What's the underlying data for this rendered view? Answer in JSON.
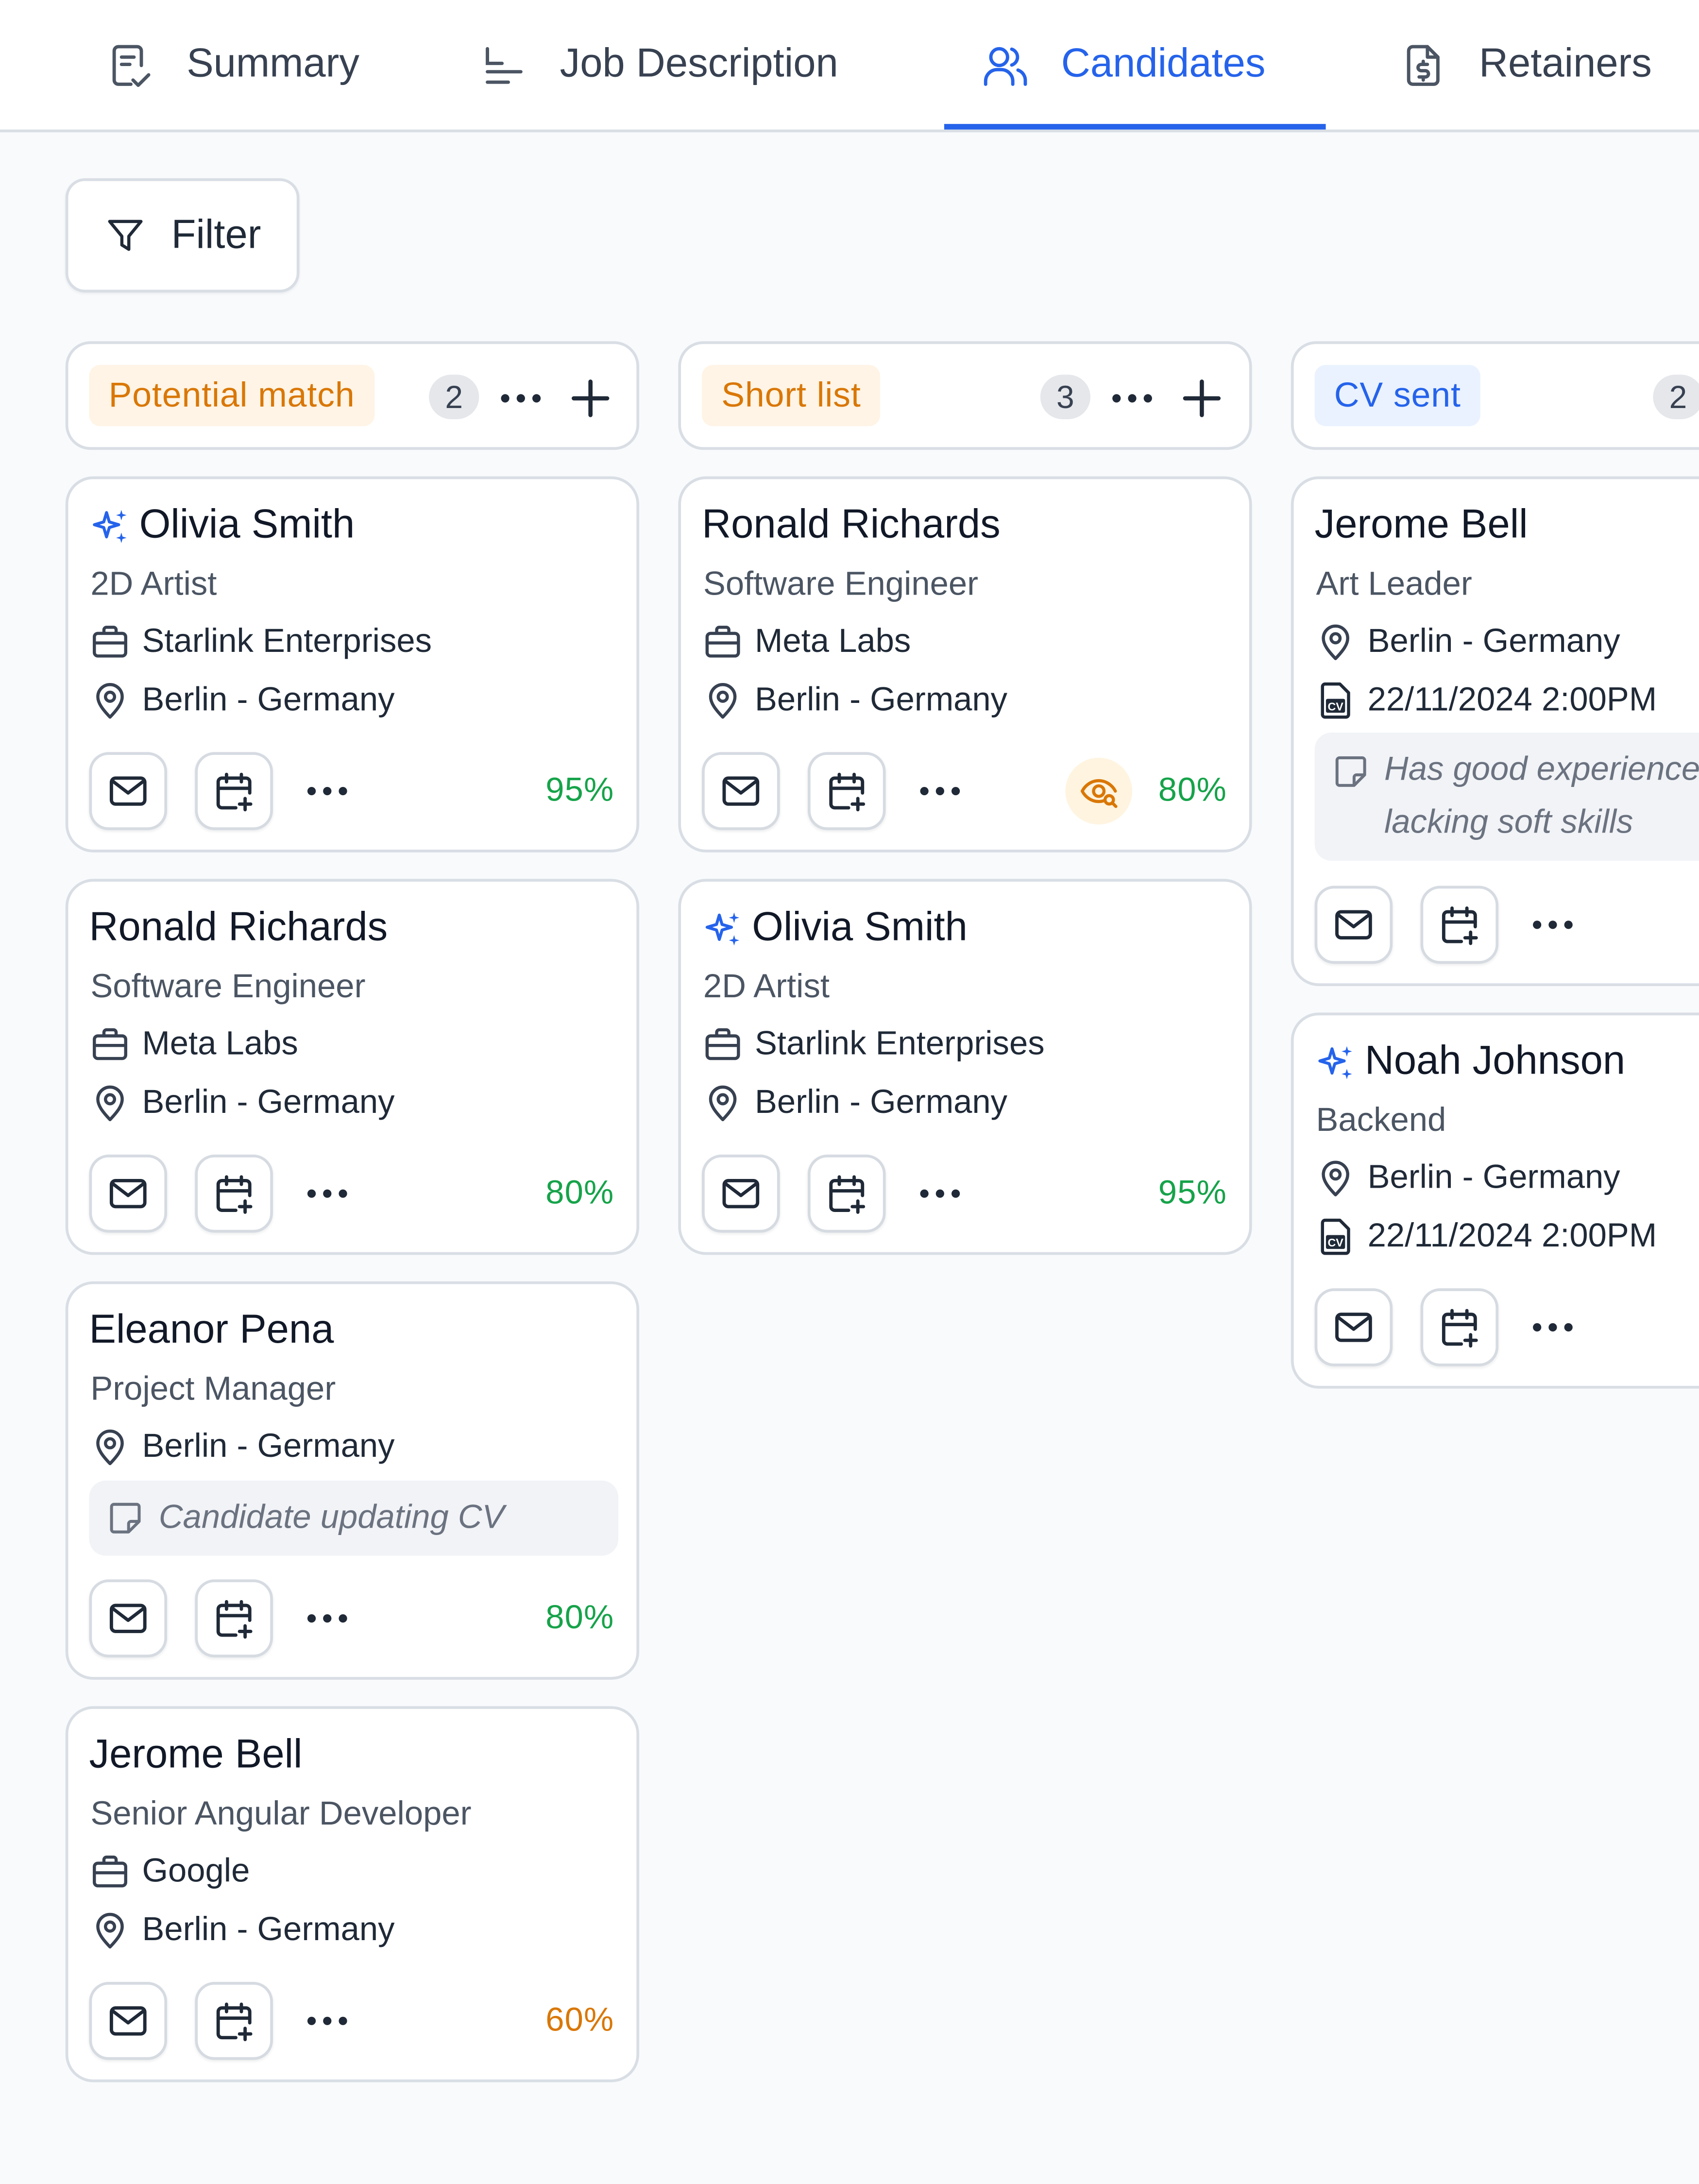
{
  "tabs": [
    {
      "label": "Summary",
      "icon": "clipboard-check-icon"
    },
    {
      "label": "Job Description",
      "icon": "align-left-icon"
    },
    {
      "label": "Candidates",
      "icon": "users-icon"
    },
    {
      "label": "Retainers",
      "icon": "file-dollar-icon"
    }
  ],
  "active_tab": "Candidates",
  "filter": {
    "label": "Filter",
    "icon": "filter-icon"
  },
  "colors": {
    "accent": "#2563eb",
    "green": "#16a34a",
    "orange": "#d97706"
  },
  "columns": [
    {
      "status": "Potential match",
      "count": "2",
      "cards": [
        {
          "name": "Olivia Smith",
          "ai": true,
          "role": "2D Artist",
          "company": "Starlink Enterprises",
          "location": "Berlin - Germany",
          "match": "95%"
        },
        {
          "name": "Ronald Richards",
          "ai": false,
          "role": "Software Engineer",
          "company": "Meta Labs",
          "location": "Berlin - Germany",
          "match": "80%"
        },
        {
          "name": "Eleanor Pena",
          "ai": false,
          "role": "Project Manager",
          "location": "Berlin - Germany",
          "note": "Candidate updating CV",
          "match": "80%"
        },
        {
          "name": "Jerome Bell",
          "ai": false,
          "role": "Senior Angular Developer",
          "company": "Google",
          "location": "Berlin - Germany",
          "match": "60%"
        }
      ]
    },
    {
      "status": "Short list",
      "count": "3",
      "cards": [
        {
          "name": "Ronald Richards",
          "ai": false,
          "role": "Software Engineer",
          "company": "Meta Labs",
          "location": "Berlin - Germany",
          "match": "80%",
          "viewed": true
        },
        {
          "name": "Olivia Smith",
          "ai": true,
          "role": "2D Artist",
          "company": "Starlink Enterprises",
          "location": "Berlin - Germany",
          "match": "95%"
        }
      ]
    },
    {
      "status": "CV sent",
      "count": "2",
      "cards": [
        {
          "name": "Jerome Bell",
          "ai": false,
          "role": "Art Leader",
          "location": "Berlin - Germany",
          "cv_sent": "22/11/2024 2:00PM",
          "note_line1": "Has good experience but",
          "note_line2": "lacking soft skills"
        },
        {
          "name": "Noah Johnson",
          "ai": true,
          "role": "Backend",
          "location": "Berlin - Germany",
          "cv_sent": "22/11/2024 2:00PM"
        }
      ]
    }
  ]
}
